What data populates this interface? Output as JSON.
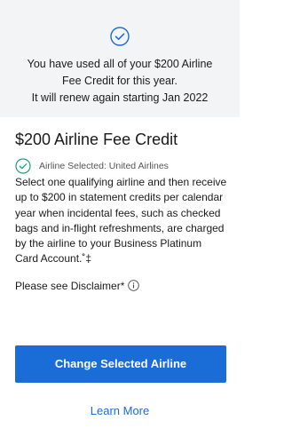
{
  "banner": {
    "icon": "check-circle-icon",
    "line1": "You have used all of your $200 Airline",
    "line2": "Fee Credit for this year.",
    "line3": "It will renew again starting Jan 2022"
  },
  "benefit": {
    "title": "$200 Airline Fee Credit",
    "selected_icon": "check-circle-icon",
    "selected_text": "Airline Selected: United Airlines",
    "description": "Select one qualifying airline and then receive up to $200 in statement credits per calendar year when incidental fees, such as checked bags and in-flight refreshments, are charged by the airline to your Business Platinum Card Account.˚‡",
    "disclaimer_text": "Please see Disclaimer*",
    "disclaimer_icon": "info-icon"
  },
  "actions": {
    "change_airline_label": "Change Selected Airline",
    "learn_more_label": "Learn More"
  },
  "colors": {
    "accent": "#1a6cd6",
    "banner_bg": "#f3f4f6",
    "success": "#1aa37a"
  }
}
